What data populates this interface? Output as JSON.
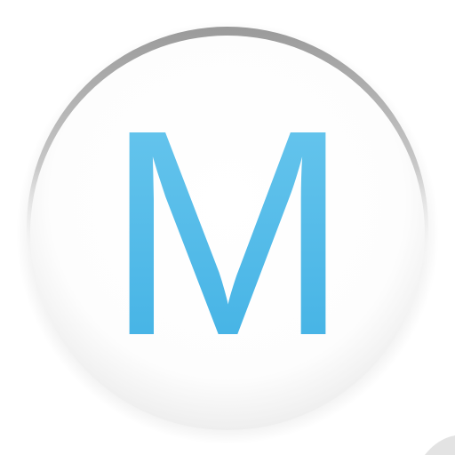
{
  "icon": {
    "letter": "M",
    "letter_color": "#4DB8E8",
    "disc_color": "#FFFFFF",
    "rim_color": "#A8A8A8"
  }
}
